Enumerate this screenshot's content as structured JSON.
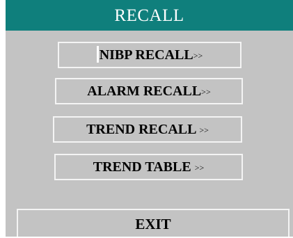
{
  "title": "RECALL",
  "menu": {
    "items": [
      {
        "label": "NIBP RECALL",
        "arrow": ">>"
      },
      {
        "label": "ALARM RECALL",
        "arrow": ">>"
      },
      {
        "label": "TREND RECALL",
        "arrow": ">>"
      },
      {
        "label": "TREND TABLE",
        "arrow": ">>"
      }
    ],
    "exit_label": "EXIT"
  },
  "colors": {
    "title_bar": "#0f7f7c",
    "panel_background": "#c3c3c3",
    "button_border": "#f4f4f4",
    "text": "#000000",
    "title_text": "#ffffff"
  }
}
